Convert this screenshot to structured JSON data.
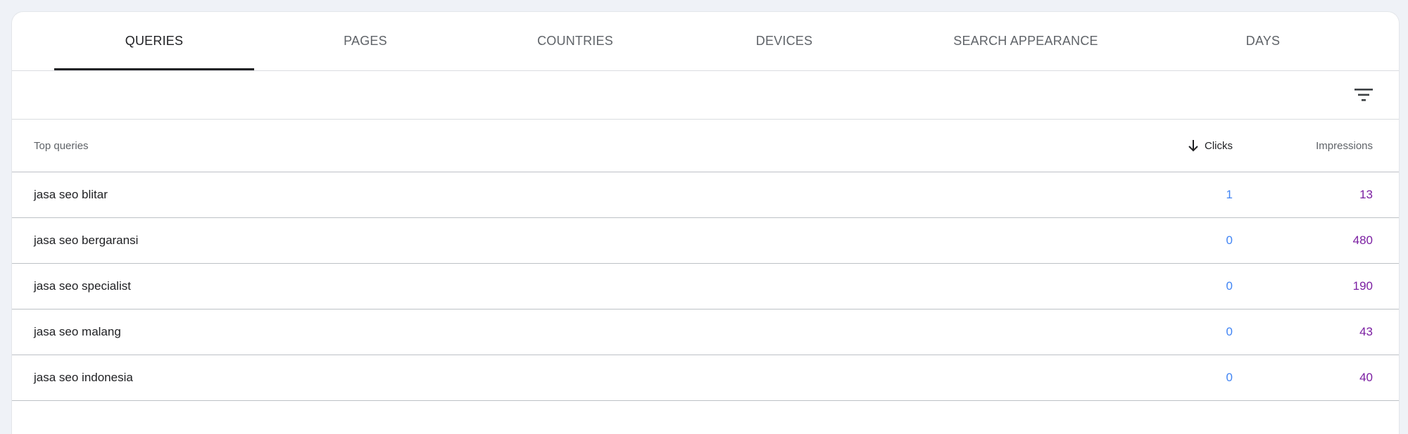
{
  "tabs": [
    {
      "label": "QUERIES",
      "active": true
    },
    {
      "label": "PAGES",
      "active": false
    },
    {
      "label": "COUNTRIES",
      "active": false
    },
    {
      "label": "DEVICES",
      "active": false
    },
    {
      "label": "SEARCH APPEARANCE",
      "active": false
    },
    {
      "label": "DAYS",
      "active": false
    }
  ],
  "filter": {
    "icon": "filter-icon"
  },
  "table": {
    "headers": {
      "query": "Top queries",
      "clicks": "Clicks",
      "impressions": "Impressions",
      "sort_icon": "arrow-down-icon"
    },
    "rows": [
      {
        "query": "jasa seo blitar",
        "clicks": "1",
        "impressions": "13"
      },
      {
        "query": "jasa seo bergaransi",
        "clicks": "0",
        "impressions": "480"
      },
      {
        "query": "jasa seo specialist",
        "clicks": "0",
        "impressions": "190"
      },
      {
        "query": "jasa seo malang",
        "clicks": "0",
        "impressions": "43"
      },
      {
        "query": "jasa seo indonesia",
        "clicks": "0",
        "impressions": "40"
      }
    ]
  },
  "colors": {
    "clicks": "#4285f4",
    "impressions": "#7b1fa2",
    "active_tab_underline": "#202124",
    "background": "#eff2f7"
  }
}
